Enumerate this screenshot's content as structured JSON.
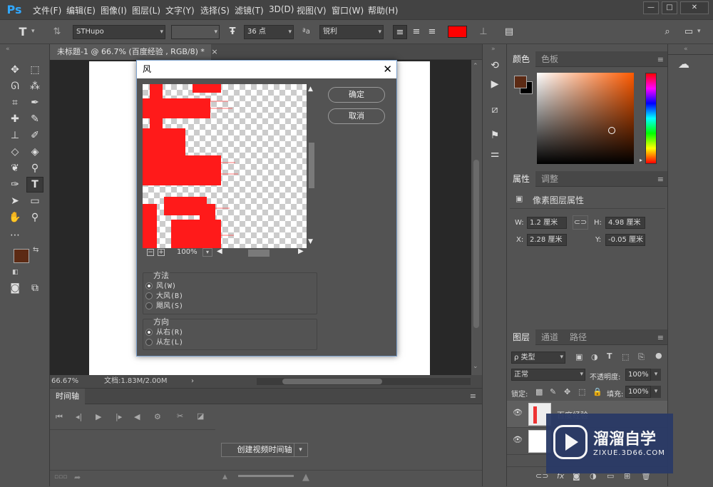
{
  "app": {
    "logo": "Ps"
  },
  "menu": [
    "文件(F)",
    "编辑(E)",
    "图像(I)",
    "图层(L)",
    "文字(Y)",
    "选择(S)",
    "滤镜(T)",
    "3D(D)",
    "视图(V)",
    "窗口(W)",
    "帮助(H)"
  ],
  "window_controls": {
    "minimize": "—",
    "restore": "□",
    "close": "✕"
  },
  "options": {
    "tool_icon": "T",
    "font_family": "STHupo",
    "font_size": "36 点",
    "aa_label": "ªa",
    "antialias": "锐利",
    "text_color": "#ff0000"
  },
  "document_tab": {
    "title": "未标题-1 @ 66.7% (百度经验 , RGB/8) *",
    "close": "×"
  },
  "status": {
    "zoom": "66.67%",
    "doc_info": "文档:1.83M/2.00M",
    "arrow": "›"
  },
  "timeline": {
    "tab": "时间轴",
    "create_button": "创建视频时间轴"
  },
  "dialog": {
    "title": "风",
    "close": "✕",
    "ok": "确定",
    "cancel": "取消",
    "zoom": "100%",
    "zoom_minus": "−",
    "zoom_plus": "+",
    "method_label": "方法",
    "methods": [
      "风(W)",
      "大风(B)",
      "飓风(S)"
    ],
    "direction_label": "方向",
    "directions": [
      "从右(R)",
      "从左(L)"
    ]
  },
  "color_panel": {
    "tabs": [
      "颜色",
      "色板"
    ],
    "foreground": "#5c2a14",
    "background": "#000000"
  },
  "properties_panel": {
    "tabs": [
      "属性",
      "调整"
    ],
    "heading": "像素图层属性",
    "w_label": "W:",
    "w": "1.2 厘米",
    "h_label": "H:",
    "h": "4.98 厘米",
    "x_label": "X:",
    "x": "2.28 厘米",
    "y_label": "Y:",
    "y": "-0.05 厘米"
  },
  "layers_panel": {
    "tabs": [
      "图层",
      "通道",
      "路径"
    ],
    "filter": "ρ 类型",
    "blend": "正常",
    "opacity_label": "不透明度:",
    "opacity": "100%",
    "lock_label": "锁定:",
    "fill_label": "填充:",
    "fill": "100%",
    "layer_name": "百度经验"
  },
  "watermark": {
    "brand": "溜溜自学",
    "url": "ZIXUE.3D66.COM"
  }
}
